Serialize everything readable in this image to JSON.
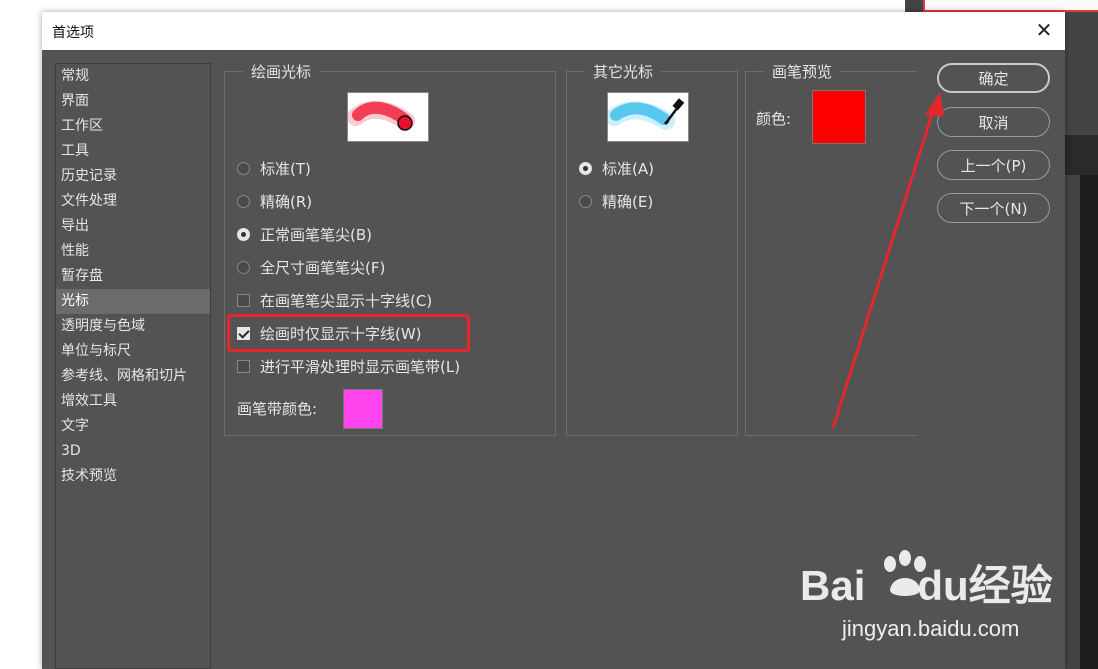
{
  "dialog": {
    "title": "首选项",
    "close_symbol": "✕"
  },
  "sidebar": {
    "items": [
      {
        "label": "常规"
      },
      {
        "label": "界面"
      },
      {
        "label": "工作区"
      },
      {
        "label": "工具"
      },
      {
        "label": "历史记录"
      },
      {
        "label": "文件处理"
      },
      {
        "label": "导出"
      },
      {
        "label": "性能"
      },
      {
        "label": "暂存盘"
      },
      {
        "label": "光标"
      },
      {
        "label": "透明度与色域"
      },
      {
        "label": "单位与标尺"
      },
      {
        "label": "参考线、网格和切片"
      },
      {
        "label": "增效工具"
      },
      {
        "label": "文字"
      },
      {
        "label": "3D"
      },
      {
        "label": "技术预览"
      }
    ],
    "active_label": "光标"
  },
  "painting_cursors": {
    "legend": "绘画光标",
    "preview_icon": "red-brush-stroke-icon",
    "options": {
      "standard": "标准(T)",
      "precise": "精确(R)",
      "normal_tip": "正常画笔笔尖(B)",
      "full_tip": "全尺寸画笔笔尖(F)"
    },
    "selected": "正常画笔笔尖(B)",
    "checkboxes": {
      "show_crosshair": {
        "label": "在画笔笔尖显示十字线(C)",
        "checked": false
      },
      "only_crosshair": {
        "label": "绘画时仅显示十字线(W)",
        "checked": true
      },
      "show_leash": {
        "label": "进行平滑处理时显示画笔带(L)",
        "checked": false
      }
    },
    "leash_color_label": "画笔带颜色:",
    "leash_color": "#ff44ee"
  },
  "other_cursors": {
    "legend": "其它光标",
    "preview_icon": "eyedropper-icon",
    "options": {
      "standard": "标准(A)",
      "precise": "精确(E)"
    },
    "selected": "标准(A)"
  },
  "brush_preview": {
    "legend": "画笔预览",
    "color_label": "颜色:",
    "color": "#ff0000"
  },
  "buttons": {
    "ok": "确定",
    "cancel": "取消",
    "prev": "上一个(P)",
    "next": "下一个(N)"
  },
  "watermark": {
    "brand_latin_1": "Bai",
    "brand_latin_2": "du",
    "brand_cn": "经验",
    "url": "jingyan.baidu.com"
  },
  "colors": {
    "annotation_red": "#e5262b",
    "dialog_bg": "#535353"
  }
}
